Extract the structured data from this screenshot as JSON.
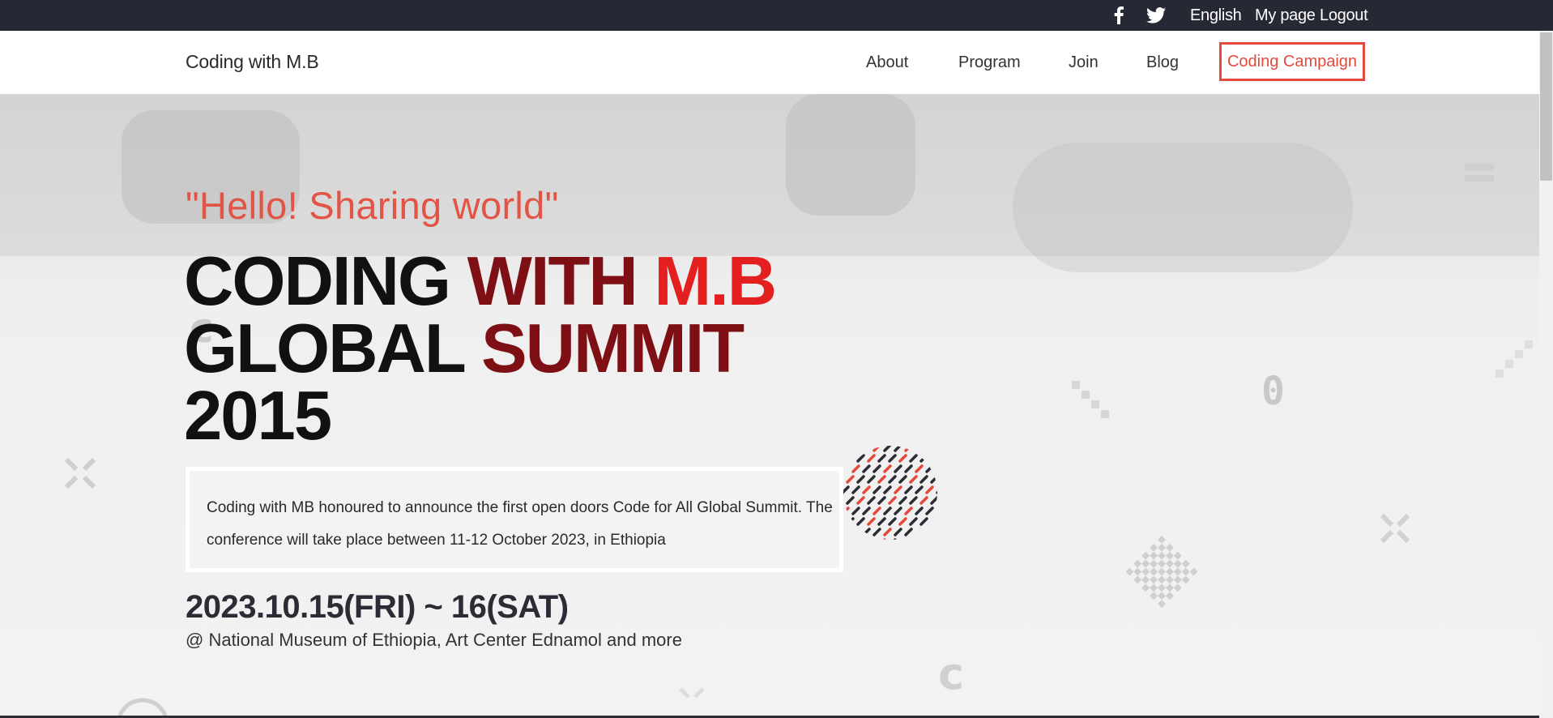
{
  "topbar": {
    "facebook_icon": "facebook-icon",
    "twitter_icon": "twitter-icon",
    "language": "English",
    "mypage": "My page",
    "logout": "Logout"
  },
  "nav": {
    "brand": "Coding with M.B",
    "about": "About",
    "program": "Program",
    "join": "Join",
    "blog": "Blog",
    "campaign": "Coding Campaign"
  },
  "hero": {
    "quote": "\"Hello! Sharing world\"",
    "line1_a": "CODING ",
    "line1_b": "WITH ",
    "line1_c": "M.B",
    "line2_a": "GLOBAL ",
    "line2_b": "SUMMIT",
    "line3": "2015",
    "description": "Coding with MB honoured to announce the first open doors Code for All Global Summit. The conference will take place between 11-12 October 2023, in Ethiopia",
    "date": "2023.10.15(FRI) ~ 16(SAT)",
    "venue": "@ National Museum of Ethiopia, Art Center Ednamol and more"
  },
  "colors": {
    "topbar_bg": "#262834",
    "accent": "#e44a3c",
    "quote": "#e25445",
    "headline_dark": "#111111",
    "headline_red": "#e3201f"
  }
}
